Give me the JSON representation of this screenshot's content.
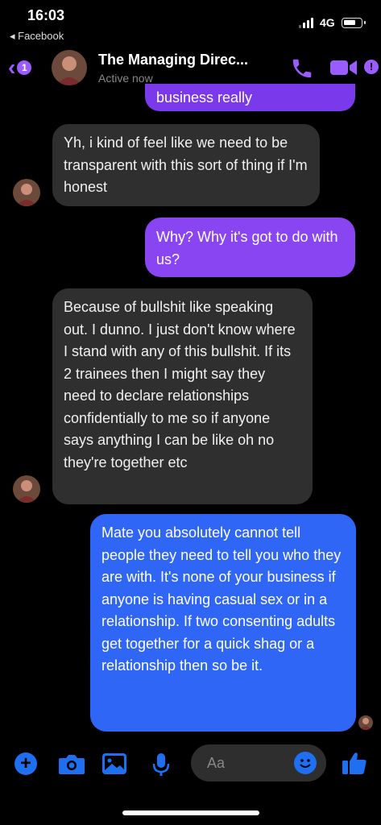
{
  "status_bar": {
    "time": "16:03",
    "back_app": "◂ Facebook",
    "network": "4G"
  },
  "header": {
    "back_badge": "1",
    "title": "The Managing Direc...",
    "subtitle": "Active now",
    "info": "!"
  },
  "messages": [
    {
      "direction": "outgoing",
      "text": "business really"
    },
    {
      "direction": "incoming",
      "text": "Yh, i kind of feel like we need to be transparent with this sort of thing if I'm honest"
    },
    {
      "direction": "outgoing",
      "text": "Why? Why it's got to do with us?"
    },
    {
      "direction": "incoming",
      "text": "Because of bullshit like speaking out. I dunno. I just don't know where I stand with any of this bullshit. If its 2 trainees then I might say they need to declare relationships confidentially to me so if anyone says anything I can be like oh no they're together etc"
    },
    {
      "direction": "outgoing",
      "text": "Mate you absolutely cannot tell people they need to tell you who they are with. It's none of your business if anyone is having casual sex or in a relationship. If two consenting adults get together for a quick shag or a relationship then so be it."
    }
  ],
  "composer": {
    "plus": "+",
    "placeholder": "Aa"
  },
  "colors": {
    "accent_purple": "#9b5cff",
    "outgoing_purple": "#8a45f2",
    "outgoing_blue": "#2f66f5",
    "incoming_gray": "#2f2f2f",
    "icon_blue": "#1f6ff2"
  },
  "icons": [
    "chevron-left-icon",
    "phone-icon",
    "video-camera-icon",
    "info-icon",
    "plus-icon",
    "camera-icon",
    "gallery-icon",
    "microphone-icon",
    "emoji-icon",
    "thumbs-up-icon"
  ]
}
